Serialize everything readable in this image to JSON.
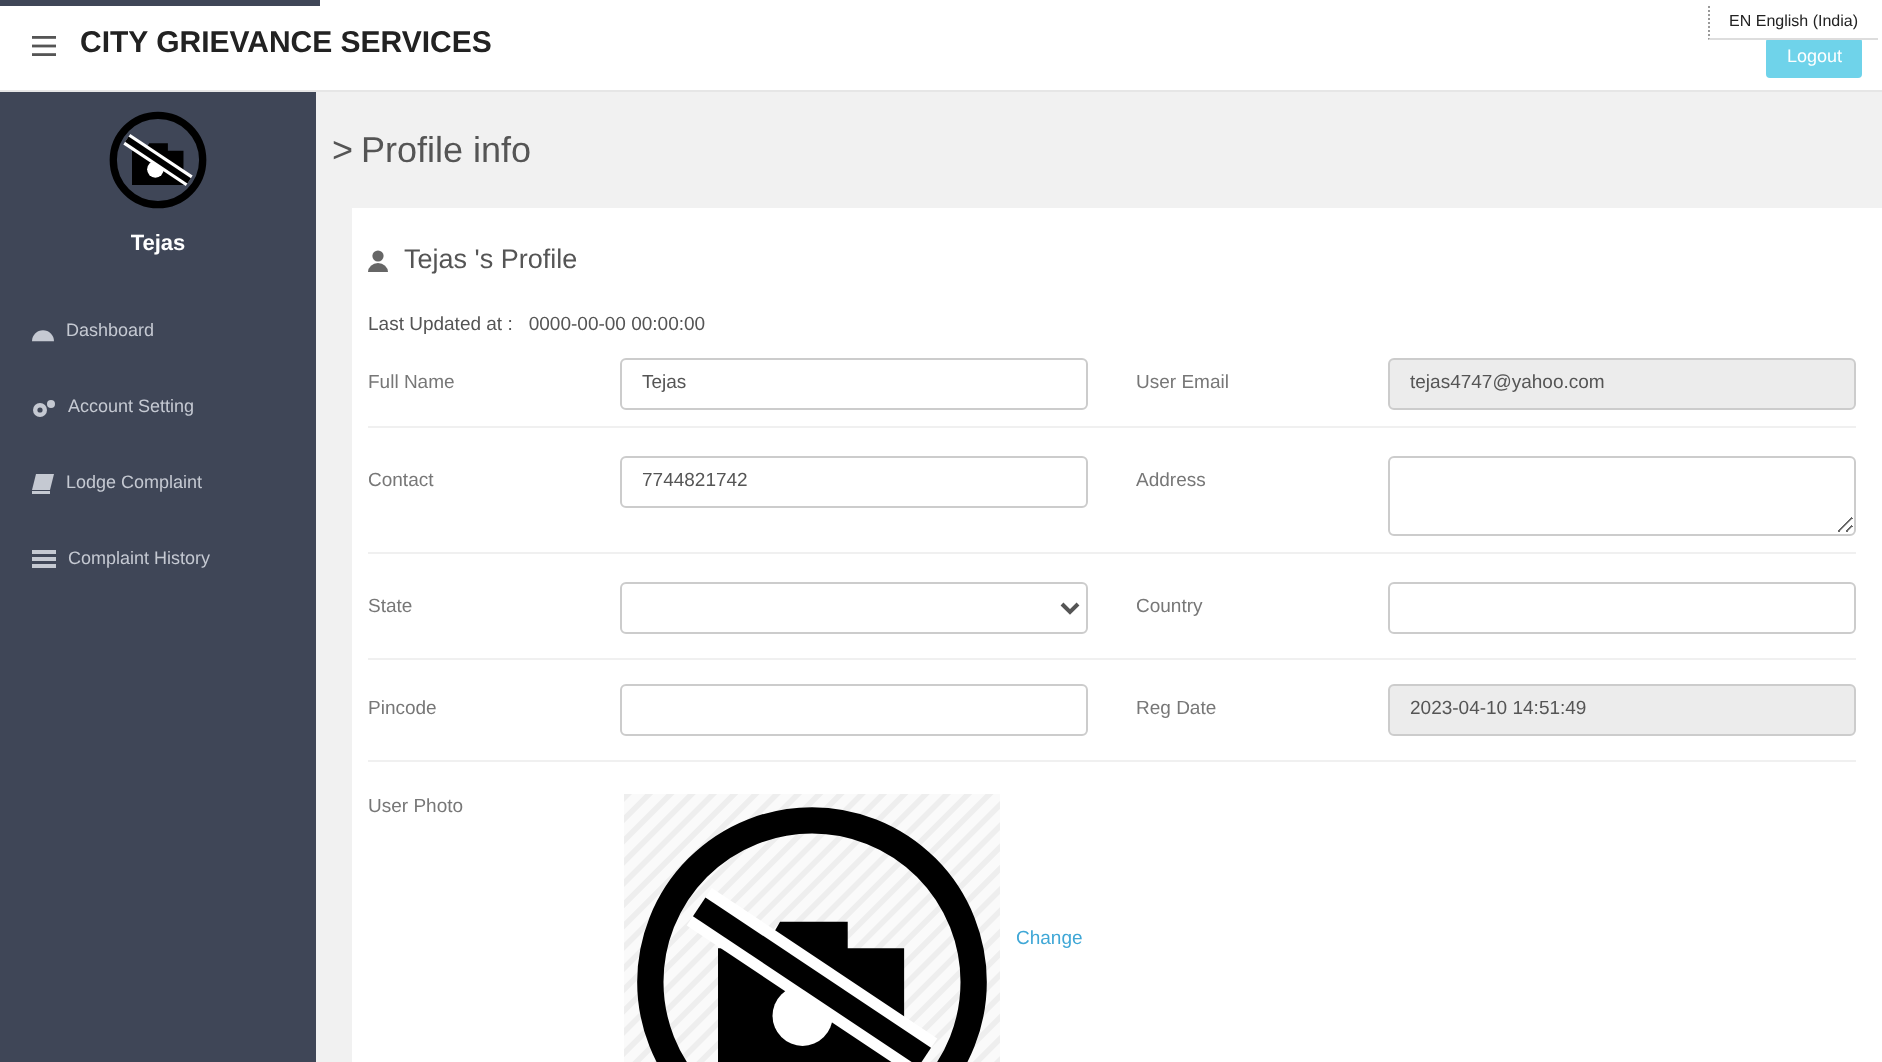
{
  "header": {
    "title": "CITY GRIEVANCE SERVICES",
    "language": "EN English (India)",
    "logout": "Logout"
  },
  "sidebar": {
    "user": "Tejas",
    "items": [
      {
        "label": "Dashboard",
        "kind": "dashboard"
      },
      {
        "label": "Account Setting",
        "kind": "settings"
      },
      {
        "label": "Lodge Complaint",
        "kind": "book"
      },
      {
        "label": "Complaint History",
        "kind": "list"
      }
    ]
  },
  "page": {
    "marker": ">",
    "title": "Profile info"
  },
  "profile": {
    "heading": "Tejas 's Profile",
    "updated_label": "Last Updated at :",
    "updated_value": "0000-00-00 00:00:00",
    "rows": [
      [
        {
          "label": "Full Name",
          "kind": "text",
          "value": "Tejas",
          "disabled": false
        },
        {
          "label": "User Email",
          "kind": "text",
          "value": "tejas4747@yahoo.com",
          "disabled": true
        }
      ],
      [
        {
          "label": "Contact",
          "kind": "text",
          "value": "7744821742",
          "disabled": false
        },
        {
          "label": "Address",
          "kind": "textarea",
          "disabled": false
        }
      ],
      [
        {
          "label": "State",
          "kind": "select",
          "disabled": false
        },
        {
          "label": "Country",
          "kind": "text",
          "disabled": false
        }
      ],
      [
        {
          "label": "Pincode",
          "kind": "text",
          "disabled": false
        },
        {
          "label": "Reg Date",
          "kind": "text",
          "value": "2023-04-10 14:51:49",
          "disabled": true
        }
      ]
    ],
    "photo_label": "User Photo",
    "change": "Change"
  }
}
